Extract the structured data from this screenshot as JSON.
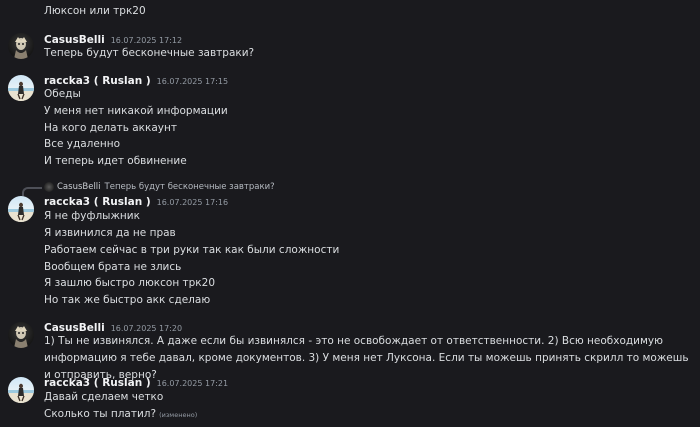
{
  "messages": [
    {
      "lines": [
        "Люксон или трк20"
      ]
    },
    {
      "author": "CasusBelli",
      "timestamp": "16.07.2025 17:12",
      "lines": [
        "Теперь будут бесконечные завтраки?"
      ]
    },
    {
      "author": "raccka3 ( Ruslan )",
      "timestamp": "16.07.2025 17:15",
      "lines": [
        "Обеды",
        "У меня нет никакой информации",
        "На кого делать аккаунт",
        "Все удаленно",
        "И теперь идет обвинение"
      ]
    },
    {
      "reply": {
        "author": "CasusBelli",
        "text": "Теперь будут бесконечные завтраки?"
      },
      "author": "raccka3 ( Ruslan )",
      "timestamp": "16.07.2025 17:16",
      "lines": [
        "Я не фуфлыжник",
        "Я извинился да не прав",
        "Работаем сейчас в три руки так как были сложности",
        "Вообщем брата не злись",
        "Я зашлю быстро люксон трк20",
        "Но так же быстро акк сделаю"
      ]
    },
    {
      "author": "CasusBelli",
      "timestamp": "16.07.2025 17:20",
      "lines": [
        "1) Ты не извинялся. А даже если бы извинялся - это не освобождает от ответственности. 2) Всю необходимую информацию я тебе давал, кроме документов. 3) У меня нет Луксона. Если ты можешь принять скрилл то можешь и отправить, верно?"
      ]
    },
    {
      "author": "raccka3 ( Ruslan )",
      "timestamp": "16.07.2025 17:21",
      "lines": [
        "Давай сделаем четко",
        "Сколько  ты платил?"
      ],
      "edited_label": "(изменено)"
    }
  ]
}
